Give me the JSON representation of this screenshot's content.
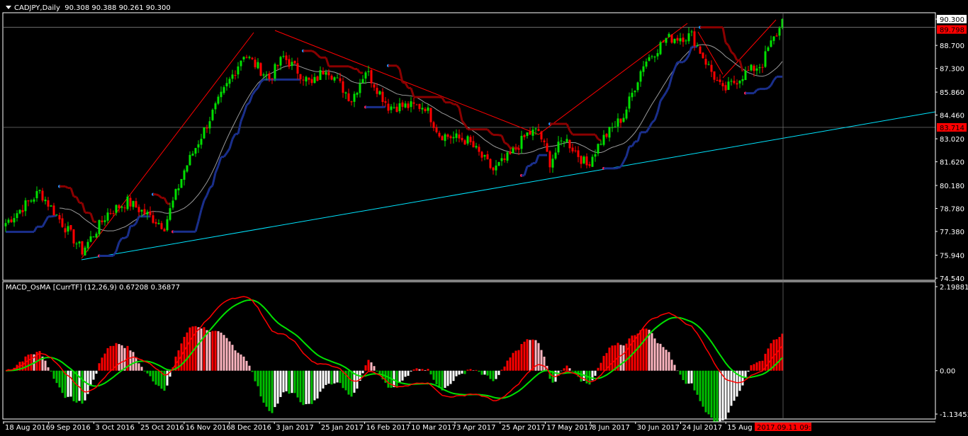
{
  "header": {
    "symbol": "CADJPY,Daily",
    "ohlc": "90.308 90.388 90.261 90.300"
  },
  "macd_panel": {
    "label": "MACD_OsMA [CurrTF] (12,26,9) 0.67208 0.36877"
  },
  "chart_data": {
    "type": "candlestick",
    "title": "CADJPY,Daily",
    "price_ticks": [
      "90.300",
      "88.700",
      "87.300",
      "85.860",
      "84.460",
      "83.020",
      "81.620",
      "80.180",
      "78.780",
      "77.380",
      "75.940",
      "74.540"
    ],
    "ylim": [
      74.54,
      90.3
    ],
    "current_price": {
      "label": "90.300",
      "value": 90.3
    },
    "hlines": [
      {
        "label": "89.798",
        "value": 89.798,
        "color": "#ff0000"
      },
      {
        "label": "83.714",
        "value": 83.714,
        "color": "#ff0000"
      }
    ],
    "date_ticks": [
      "18 Aug 2016",
      "9 Sep 2016",
      "3 Oct 2016",
      "25 Oct 2016",
      "16 Nov 2016",
      "8 Dec 2016",
      "3 Jan 2017",
      "25 Jan 2017",
      "16 Feb 2017",
      "10 Mar 2017",
      "3 Apr 2017",
      "25 Apr 2017",
      "17 May 2017",
      "8 Jun 2017",
      "30 Jun 2017",
      "24 Jul 2017",
      "15 Aug 2017"
    ],
    "crosshair_time": "2017.09.11 09:00",
    "bars": 275,
    "close_path": [
      [
        0,
        77.9
      ],
      [
        12,
        79.8
      ],
      [
        27,
        76.2
      ],
      [
        36,
        78.5
      ],
      [
        43,
        79.2
      ],
      [
        56,
        77.7
      ],
      [
        63,
        81.1
      ],
      [
        73,
        84.6
      ],
      [
        84,
        88.2
      ],
      [
        93,
        86.7
      ],
      [
        98,
        88.0
      ],
      [
        108,
        86.3
      ],
      [
        113,
        87.4
      ],
      [
        122,
        85.4
      ],
      [
        127,
        87.2
      ],
      [
        135,
        85.0
      ],
      [
        148,
        85.0
      ],
      [
        153,
        83.3
      ],
      [
        163,
        82.9
      ],
      [
        172,
        81.1
      ],
      [
        178,
        82.0
      ],
      [
        184,
        83.3
      ],
      [
        188,
        83.5
      ],
      [
        192,
        81.6
      ],
      [
        197,
        83.1
      ],
      [
        205,
        81.4
      ],
      [
        210,
        82.9
      ],
      [
        218,
        84.4
      ],
      [
        225,
        87.6
      ],
      [
        233,
        89.1
      ],
      [
        242,
        89.3
      ],
      [
        248,
        87.4
      ],
      [
        253,
        85.9
      ],
      [
        260,
        86.9
      ],
      [
        267,
        87.6
      ],
      [
        269,
        88.5
      ],
      [
        273,
        89.7
      ],
      [
        274,
        90.3
      ]
    ],
    "macd": {
      "params": [
        12,
        26,
        9
      ],
      "ylim": [
        -1.13453,
        2.19881
      ],
      "ticks": [
        "2.19881",
        "0.00",
        "-1.13453"
      ],
      "values": [
        0.67208,
        0.36877
      ]
    },
    "colors": {
      "bull": "#00e000",
      "bear": "#ff0000",
      "ma": "#9a9a9a",
      "trend": "#00e5ff",
      "stop_up": "#1a2f8c",
      "stop_down": "#8b0000",
      "macd": "#ff0000",
      "signal": "#00e000",
      "hist_up": "#ff0000",
      "hist_up_fall": "#ffb6c1",
      "hist_dn": "#00c000",
      "hist_dn_rise": "#ffffff"
    }
  }
}
